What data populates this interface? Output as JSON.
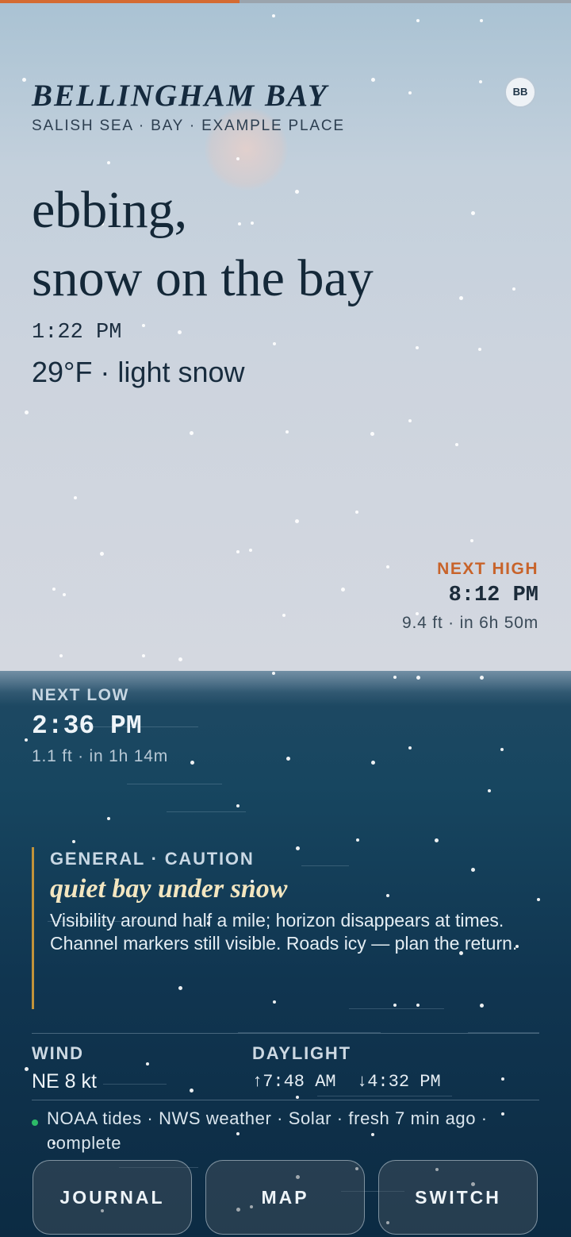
{
  "tide_progress": 0.42,
  "colors": {
    "accent_orange": "#c8632a",
    "advisory_bar": "#c2933a",
    "status_green": "#2dbb68"
  },
  "location": {
    "title": "BELLINGHAM BAY",
    "subtitle": "SALISH SEA · BAY · EXAMPLE PLACE",
    "avatar_initials": "BB"
  },
  "headline": {
    "line1": "ebbing,",
    "line2": "snow on the bay"
  },
  "now": {
    "time": "1:22 PM",
    "conditions": "29°F · light snow"
  },
  "next_high": {
    "label": "NEXT HIGH",
    "time": "8:12 PM",
    "detail": "9.4 ft · in 6h 50m"
  },
  "next_low": {
    "label": "NEXT LOW",
    "time": "2:36 PM",
    "detail": "1.1 ft · in 1h 14m"
  },
  "advisory": {
    "category": "GENERAL · CAUTION",
    "title": "quiet bay under snow",
    "body_line1": "Visibility around half a mile; horizon disappears at times.",
    "body_line2": "Channel markers still visible. Roads icy — plan the return."
  },
  "wind": {
    "label": "WIND",
    "value": "NE 8 kt"
  },
  "daylight": {
    "label": "DAYLIGHT",
    "sunrise": "↑7:48 AM",
    "sunset": "↓4:32 PM"
  },
  "sources": {
    "text": "NOAA tides · NWS weather · Solar · fresh 7 min ago · complete"
  },
  "buttons": {
    "journal": "JOURNAL",
    "map": "MAP",
    "switch": "SWITCH"
  }
}
